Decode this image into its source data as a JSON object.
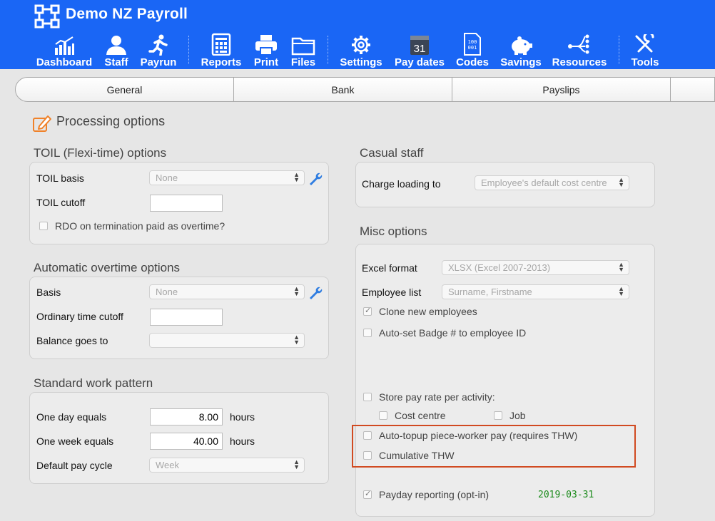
{
  "app": {
    "title": "Demo NZ Payroll"
  },
  "toolbar": {
    "items": [
      {
        "label": "Dashboard",
        "icon": "dashboard-icon"
      },
      {
        "label": "Staff",
        "icon": "staff-icon"
      },
      {
        "label": "Payrun",
        "icon": "payrun-icon"
      },
      {
        "label": "Reports",
        "icon": "reports-icon"
      },
      {
        "label": "Print",
        "icon": "print-icon"
      },
      {
        "label": "Files",
        "icon": "folder-icon"
      },
      {
        "label": "Settings",
        "icon": "gear-icon"
      },
      {
        "label": "Pay dates",
        "icon": "calendar-icon",
        "calendar_day": "31"
      },
      {
        "label": "Codes",
        "icon": "codes-icon",
        "codes_text": [
          "100",
          "001"
        ]
      },
      {
        "label": "Savings",
        "icon": "piggy-bank-icon"
      },
      {
        "label": "Resources",
        "icon": "resources-icon"
      },
      {
        "label": "Tools",
        "icon": "tools-icon"
      }
    ]
  },
  "tabs": [
    "General",
    "Bank",
    "Payslips",
    ""
  ],
  "page": {
    "title": "Processing options"
  },
  "toil": {
    "title": "TOIL (Flexi-time) options",
    "basis_label": "TOIL basis",
    "basis_value": "None",
    "cutoff_label": "TOIL cutoff",
    "cutoff_value": "",
    "rdo_label": "RDO on termination paid as overtime?",
    "rdo_checked": false
  },
  "overtime": {
    "title": "Automatic overtime options",
    "basis_label": "Basis",
    "basis_value": "None",
    "cutoff_label": "Ordinary time cutoff",
    "cutoff_value": "",
    "balance_label": "Balance goes to",
    "balance_value": ""
  },
  "work_pattern": {
    "title": "Standard work pattern",
    "day_label": "One day equals",
    "day_value": "8.00",
    "week_label": "One week equals",
    "week_value": "40.00",
    "unit": "hours",
    "cycle_label": "Default pay cycle",
    "cycle_value": "Week"
  },
  "casual": {
    "title": "Casual staff",
    "charge_label": "Charge loading to",
    "charge_value": "Employee's default cost centre"
  },
  "misc": {
    "title": "Misc options",
    "excel_label": "Excel format",
    "excel_value": "XLSX (Excel 2007-2013)",
    "employee_list_label": "Employee list",
    "employee_list_value": "Surname, Firstname",
    "clone_label": "Clone new employees",
    "clone_checked": true,
    "badge_label": "Auto-set Badge # to employee ID",
    "badge_checked": false,
    "store_rate_label": "Store pay rate per activity:",
    "store_rate_checked": false,
    "cost_centre_label": "Cost centre",
    "cost_centre_checked": false,
    "job_label": "Job",
    "job_checked": false,
    "topup_label": "Auto-topup piece-worker pay (requires THW)",
    "topup_checked": false,
    "cumulative_label": "Cumulative THW",
    "cumulative_checked": false,
    "payday_label": "Payday reporting (opt-in)",
    "payday_checked": true,
    "payday_date": "2019-03-31"
  },
  "colors": {
    "header_bg": "#1a66f5",
    "highlight_border": "#d14a21",
    "date_text": "#1a8a1a",
    "icon_accent": "#2f7de1"
  }
}
